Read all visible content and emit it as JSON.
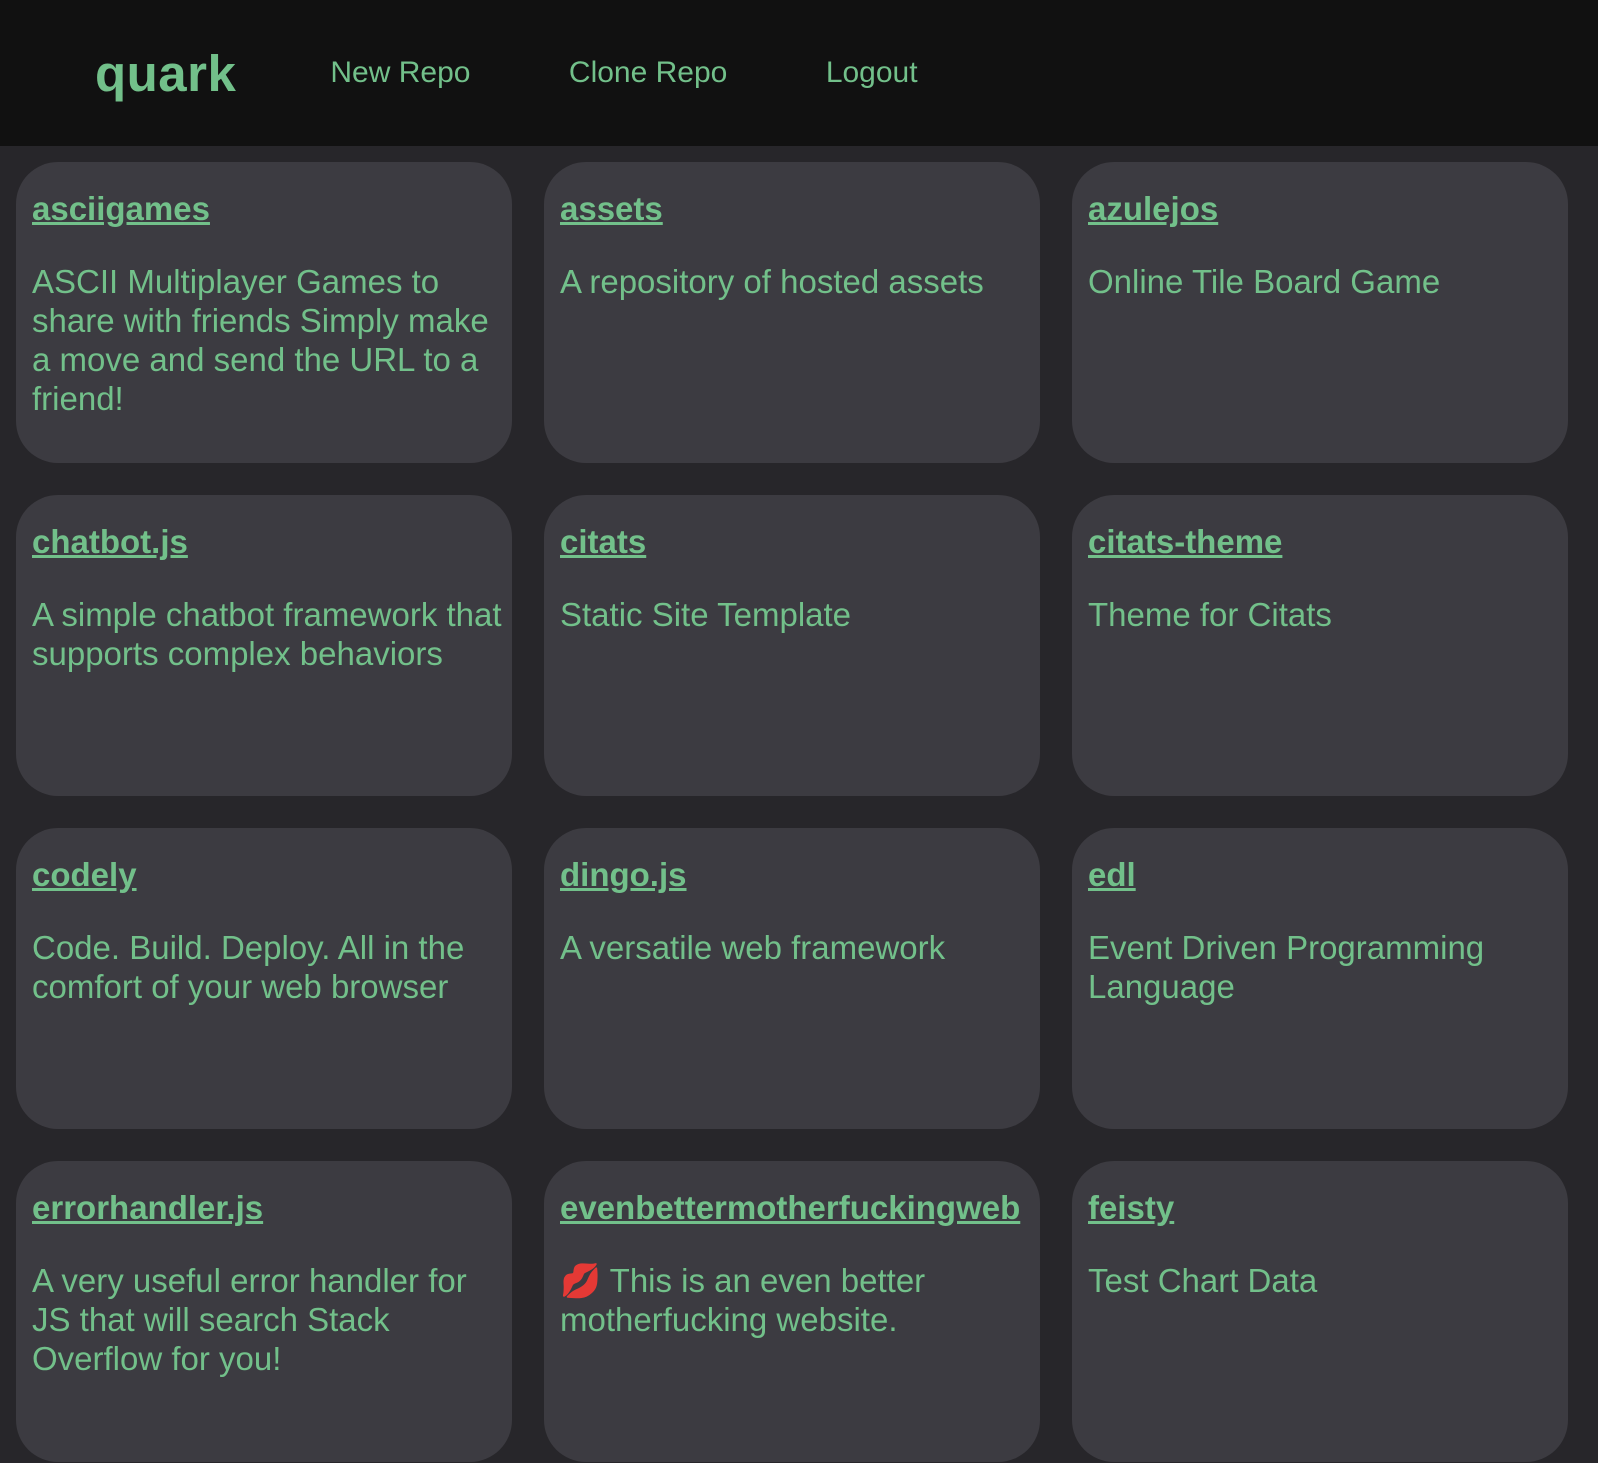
{
  "header": {
    "logo": "quark",
    "nav": [
      "New Repo",
      "Clone Repo",
      "Logout"
    ]
  },
  "repos": [
    {
      "name": "asciigames",
      "description": "ASCII Multiplayer Games to share with friends Simply make a move and send the URL to a friend!"
    },
    {
      "name": "assets",
      "description": "A repository of hosted assets"
    },
    {
      "name": "azulejos",
      "description": "Online Tile Board Game"
    },
    {
      "name": "chatbot.js",
      "description": "A simple chatbot framework that supports complex behaviors"
    },
    {
      "name": "citats",
      "description": "Static Site Template"
    },
    {
      "name": "citats-theme",
      "description": "Theme for Citats"
    },
    {
      "name": "codely",
      "description": "Code. Build. Deploy. All in the comfort of your web browser"
    },
    {
      "name": "dingo.js",
      "description": "A versatile web framework"
    },
    {
      "name": "edl",
      "description": "Event Driven Programming Language"
    },
    {
      "name": "errorhandler.js",
      "description": "A very useful error handler for JS that will search Stack Overflow for you!"
    },
    {
      "name": "evenbettermotherfuckingweb",
      "description": "💋 This is an even better motherfucking website."
    },
    {
      "name": "feisty",
      "description": "Test Chart Data"
    }
  ]
}
